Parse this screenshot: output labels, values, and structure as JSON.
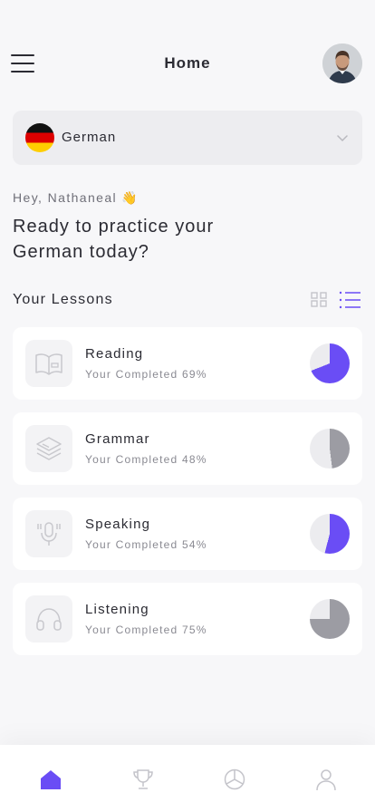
{
  "header": {
    "title": "Home",
    "menu_icon": "hamburger-menu-icon",
    "avatar": "user-avatar"
  },
  "language": {
    "selected": "German",
    "flag": "germany-flag",
    "chevron_icon": "chevron-down-icon"
  },
  "greeting": {
    "hey": "Hey, Nathaneal 👋",
    "headline": "Ready to practice your German today?"
  },
  "lessons_section": {
    "title": "Your Lessons",
    "view_icons": [
      "grid-view-icon",
      "list-view-icon"
    ]
  },
  "lessons": [
    {
      "name": "Reading",
      "progress_text": "Your Completed 69%",
      "percent": 69,
      "icon": "book-icon",
      "color": "#6a4df5"
    },
    {
      "name": "Grammar",
      "progress_text": "Your Completed 48%",
      "percent": 48,
      "icon": "stack-icon",
      "color": "#9c9ca3"
    },
    {
      "name": "Speaking",
      "progress_text": "Your Completed 54%",
      "percent": 54,
      "icon": "microphone-icon",
      "color": "#6a4df5"
    },
    {
      "name": "Listening",
      "progress_text": "Your Completed 75%",
      "percent": 75,
      "icon": "headphones-icon",
      "color": "#9c9ca3"
    }
  ],
  "tabbar": {
    "tabs": [
      "home-icon",
      "trophy-icon",
      "stats-icon",
      "profile-icon"
    ],
    "active": "home-icon"
  },
  "colors": {
    "accent": "#6a4df5",
    "muted": "#9c9ca3",
    "pie_track": "#ececef"
  }
}
